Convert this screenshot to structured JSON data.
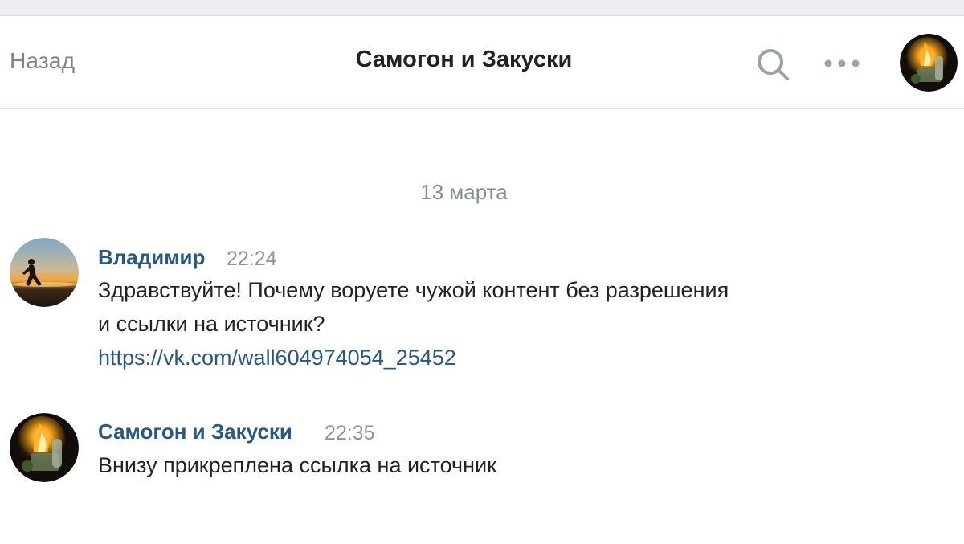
{
  "header": {
    "back_label": "Назад",
    "title": "Самогон и Закуски",
    "search_icon": "search-icon",
    "more_icon": "more-dots-icon",
    "avatar_icon": "group-avatar"
  },
  "chat": {
    "date_separator": "13 марта",
    "messages": [
      {
        "author": "Владимир",
        "time": "22:24",
        "lines": [
          "Здравствуйте! Почему воруете чужой контент без разрешения",
          "и ссылки на источник?"
        ],
        "link": "https://vk.com/wall604974054_25452",
        "avatar": "runner-sunset-avatar"
      },
      {
        "author": "Самогон и Закуски",
        "time": "22:35",
        "lines": [
          "Внизу прикреплена ссылка на источник"
        ],
        "avatar": "group-avatar"
      }
    ]
  },
  "colors": {
    "accent_link": "#2a5885",
    "text": "#222222",
    "muted": "#828282",
    "header_border": "#dce1e6"
  }
}
